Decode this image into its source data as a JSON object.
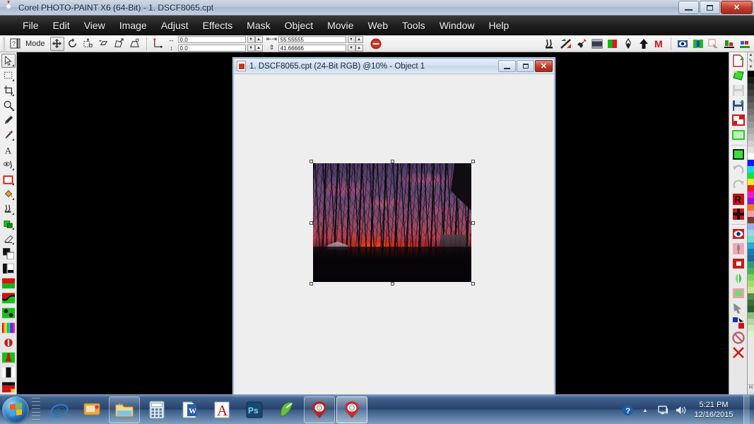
{
  "window": {
    "title": "Corel PHOTO-PAINT X6 (64-Bit) - 1. DSCF8065.cpt",
    "app_icon": "corel-balloon-icon",
    "minimize": "–",
    "maximize": "□",
    "close": "✕"
  },
  "menubar": {
    "items": [
      {
        "label": "File",
        "mnemonic": "F"
      },
      {
        "label": "Edit",
        "mnemonic": "E"
      },
      {
        "label": "View",
        "mnemonic": "V"
      },
      {
        "label": "Image",
        "mnemonic": "I"
      },
      {
        "label": "Adjust",
        "mnemonic": "A"
      },
      {
        "label": "Effects",
        "mnemonic": "c"
      },
      {
        "label": "Mask",
        "mnemonic": "k"
      },
      {
        "label": "Object",
        "mnemonic": "O"
      },
      {
        "label": "Movie",
        "mnemonic": "M"
      },
      {
        "label": "Web",
        "mnemonic": "W"
      },
      {
        "label": "Tools",
        "mnemonic": "T"
      },
      {
        "label": "Window",
        "mnemonic": "W"
      },
      {
        "label": "Help",
        "mnemonic": "H"
      }
    ]
  },
  "propertybar": {
    "mode_label": "Mode",
    "mode_buttons": [
      {
        "name": "position-mode",
        "icon": "four-way-arrow-icon",
        "active": true
      },
      {
        "name": "rotate-mode",
        "icon": "rotate-arrow-icon",
        "active": false
      },
      {
        "name": "scale-mode",
        "icon": "scale-box-icon",
        "active": false
      },
      {
        "name": "skew-mode",
        "icon": "skew-parallelogram-icon",
        "active": false
      },
      {
        "name": "distort-mode",
        "icon": "distort-arrow-icon",
        "active": false
      },
      {
        "name": "perspective-mode",
        "icon": "perspective-box-icon",
        "active": false
      }
    ],
    "anchor_icon": "anchor-point-icon",
    "fields": [
      {
        "name": "position-x",
        "icon": "horizontal-arrow-icon",
        "value": "0.0"
      },
      {
        "name": "position-y",
        "icon": "vertical-arrow-icon",
        "value": "0.0"
      },
      {
        "name": "size-width",
        "icon": "width-arrow-icon",
        "value": "55.55555"
      },
      {
        "name": "size-height",
        "icon": "height-arrow-icon",
        "value": "41.66666"
      }
    ],
    "spin_up": "▲",
    "spin_down": "▼",
    "apply_button": {
      "name": "apply-reset-button",
      "icon": "red-stop-icon"
    },
    "right_tools": [
      {
        "name": "clone-tool-button",
        "icon": "clone-brush-icon"
      },
      {
        "name": "effect-tool-button",
        "icon": "effect-slash-icon"
      },
      {
        "name": "red-eye-tool-button",
        "icon": "red-eye-wrench-icon"
      },
      {
        "name": "transparency-tool-button",
        "icon": "checker-square-icon"
      },
      {
        "name": "fill-tool-button",
        "icon": "green-red-fill-icon"
      },
      {
        "name": "eyedropper-tool-button",
        "icon": "dropper-icon"
      },
      {
        "name": "arrow-up-button",
        "icon": "black-arrow-up-icon"
      },
      {
        "name": "merge-button",
        "icon": "letter-m-icon"
      }
    ],
    "right_tools2": [
      {
        "name": "object-eye-button",
        "icon": "eye-object-icon"
      },
      {
        "name": "object-split-button",
        "icon": "green-split-icon"
      },
      {
        "name": "object-drop-shadow-button",
        "icon": "drop-shadow-icon"
      },
      {
        "name": "align-bottom-button",
        "icon": "align-bottom-icon"
      },
      {
        "name": "distribute-button",
        "icon": "distribute-icon"
      }
    ]
  },
  "toolbox": {
    "tools": [
      {
        "name": "pick-tool",
        "icon": "arrow-cursor-icon",
        "active": true,
        "flyout": true
      },
      {
        "name": "mask-rectangle-tool",
        "icon": "dashed-rect-icon",
        "active": false,
        "flyout": true
      },
      {
        "name": "crop-tool",
        "icon": "crop-icon",
        "active": false,
        "flyout": true
      },
      {
        "name": "zoom-tool",
        "icon": "magnifier-icon",
        "active": false,
        "flyout": true
      },
      {
        "name": "eyedropper-tool",
        "icon": "dropper-icon",
        "active": false,
        "flyout": false
      },
      {
        "name": "paint-tool",
        "icon": "paintbrush-icon",
        "active": false,
        "flyout": true
      },
      {
        "name": "text-tool",
        "icon": "letter-a-icon",
        "active": false,
        "flyout": false
      },
      {
        "name": "red-eye-tool",
        "icon": "red-eye-icon",
        "active": false,
        "flyout": true
      },
      {
        "name": "rectangle-shape-tool",
        "icon": "red-rect-icon",
        "active": false,
        "flyout": true
      },
      {
        "name": "fill-tool",
        "icon": "paint-bucket-icon",
        "active": false,
        "flyout": true
      },
      {
        "name": "clone-tool",
        "icon": "clone-stamp-icon",
        "active": false,
        "flyout": true
      },
      {
        "name": "object-pick-tool",
        "icon": "green-square-icon",
        "active": false,
        "flyout": true
      },
      {
        "name": "eraser-tool",
        "icon": "eraser-icon",
        "active": false,
        "flyout": true
      },
      {
        "name": "color-swatch-tool",
        "icon": "fill-outline-swatch-icon",
        "active": false,
        "flyout": false
      },
      {
        "name": "transparency-tool",
        "icon": "transparency-bar-icon",
        "active": false,
        "flyout": false
      }
    ],
    "swatches": [
      {
        "name": "palette-red-green-swatch",
        "icon": "red-green-bar-icon"
      },
      {
        "name": "gradient-swatch",
        "icon": "red-black-green-icon"
      },
      {
        "name": "green-pattern-swatch",
        "icon": "green-knot-icon"
      },
      {
        "name": "rainbow-swatch",
        "icon": "rainbow-stripes-icon"
      },
      {
        "name": "clip-mask-swatch",
        "icon": "red-circle-mask-icon"
      },
      {
        "name": "object-green-swatch",
        "icon": "green-red-flask-icon"
      },
      {
        "name": "black-bar-swatch",
        "icon": "black-bar-icon"
      },
      {
        "name": "german-flag-swatch",
        "icon": "black-red-yellow-icon"
      },
      {
        "name": "pink-blue-swatch",
        "icon": "pink-blue-fan-icon"
      },
      {
        "name": "magnifier-swatch",
        "icon": "red-magnifier-icon"
      }
    ]
  },
  "document": {
    "title": "1. DSCF8065.cpt (24-Bit RGB) @10% - Object 1",
    "file_name": "DSCF8065.cpt",
    "color_mode": "24-Bit RGB",
    "zoom": "@10%",
    "object": "Object 1",
    "icon": "document-icon",
    "minimize": "–",
    "maximize": "□",
    "close": "✕",
    "image_description": "Sunset sky glowing red and pink behind silhouetted bare trees"
  },
  "docker": {
    "buttons": [
      {
        "name": "new-image-button",
        "icon": "new-document-icon"
      },
      {
        "name": "new-from-clipboard-button",
        "icon": "green-shape-icon"
      },
      {
        "name": "save-button",
        "icon": "save-disk-icon",
        "disabled": true
      },
      {
        "name": "save-as-button",
        "icon": "save-as-disk-icon"
      },
      {
        "name": "crop-image-button",
        "icon": "red-crop-icon"
      },
      {
        "name": "select-all-button",
        "icon": "green-rect-icon"
      },
      {
        "name": "object-create-button",
        "icon": "green-square-icon"
      },
      {
        "name": "undo-button",
        "icon": "undo-arrow-icon",
        "disabled": true
      },
      {
        "name": "redo-button",
        "icon": "redo-arrow-icon",
        "disabled": true
      },
      {
        "name": "replace-color-button",
        "icon": "letter-r-icon"
      },
      {
        "name": "add-object-button",
        "icon": "black-cross-icon"
      },
      {
        "name": "visibility-button",
        "icon": "eye-icon"
      },
      {
        "name": "clone-object-button",
        "icon": "pink-tree-icon"
      },
      {
        "name": "object-properties-button",
        "icon": "red-white-square-icon"
      },
      {
        "name": "flip-button",
        "icon": "green-flip-icon"
      },
      {
        "name": "object-fill-button",
        "icon": "green-fill-icon"
      },
      {
        "name": "pointer-button",
        "icon": "gray-arrow-icon"
      },
      {
        "name": "swap-colors-button",
        "icon": "blue-red-swap-icon"
      },
      {
        "name": "no-fill-button",
        "icon": "no-entry-icon"
      },
      {
        "name": "delete-button",
        "icon": "red-x-icon"
      }
    ]
  },
  "palette": {
    "scroll_up": "▲",
    "scroll_down": "▼",
    "more_label": "H",
    "colors": [
      "#000000",
      "#1a1a1a",
      "#2e2e2e",
      "#3f3f3f",
      "#515151",
      "#636363",
      "#757575",
      "#878787",
      "#999999",
      "#ababab",
      "#bdbdbd",
      "#cfcfcf",
      "#e1e1e1",
      "#ffffff",
      "#1414ff",
      "#15d7f0",
      "#17e03a",
      "#f2f018",
      "#ef1a1a",
      "#f018cf",
      "#8d18e0",
      "#f07a18",
      "#f09bc0",
      "#7a3a2a",
      "#a0aee8",
      "#9ad4f0",
      "#6fe0c0",
      "#2aa8d8",
      "#1e7ab0",
      "#186d9a",
      "#2f9a7a",
      "#46b35a",
      "#7fcf5a",
      "#a8dc6a",
      "#c8e888",
      "#5a8a4a",
      "#3f6e38",
      "#2e5c30",
      "#8cc07a",
      "#b4d8a0",
      "#d0e8c0",
      "#e0f0d4"
    ]
  },
  "taskbar": {
    "start_button": "start-orb",
    "items": [
      {
        "name": "taskbar-internet-explorer",
        "icon": "ie-e-icon",
        "state": "pinned"
      },
      {
        "name": "taskbar-media-center",
        "icon": "media-center-icon",
        "state": "pinned"
      },
      {
        "name": "taskbar-explorer",
        "icon": "folder-icon",
        "state": "running"
      },
      {
        "name": "taskbar-calculator",
        "icon": "calculator-icon",
        "state": "pinned"
      },
      {
        "name": "taskbar-word",
        "icon": "word-w-icon",
        "state": "pinned"
      },
      {
        "name": "taskbar-acrobat",
        "icon": "acrobat-a-icon",
        "state": "pinned"
      },
      {
        "name": "taskbar-photoshop",
        "icon": "photoshop-ps-icon",
        "state": "pinned"
      },
      {
        "name": "taskbar-coreldraw",
        "icon": "coreldraw-pen-icon",
        "state": "pinned"
      },
      {
        "name": "taskbar-photopaint-1",
        "icon": "corel-balloon-icon",
        "state": "running"
      },
      {
        "name": "taskbar-photopaint-2",
        "icon": "corel-balloon-icon",
        "state": "active"
      }
    ],
    "tray": {
      "help_icon": "blue-question-icon",
      "show_hidden": "▲",
      "network_icon": "network-monitor-icon",
      "volume_icon": "speaker-icon",
      "time": "5:21 PM",
      "date": "12/16/2015"
    }
  }
}
